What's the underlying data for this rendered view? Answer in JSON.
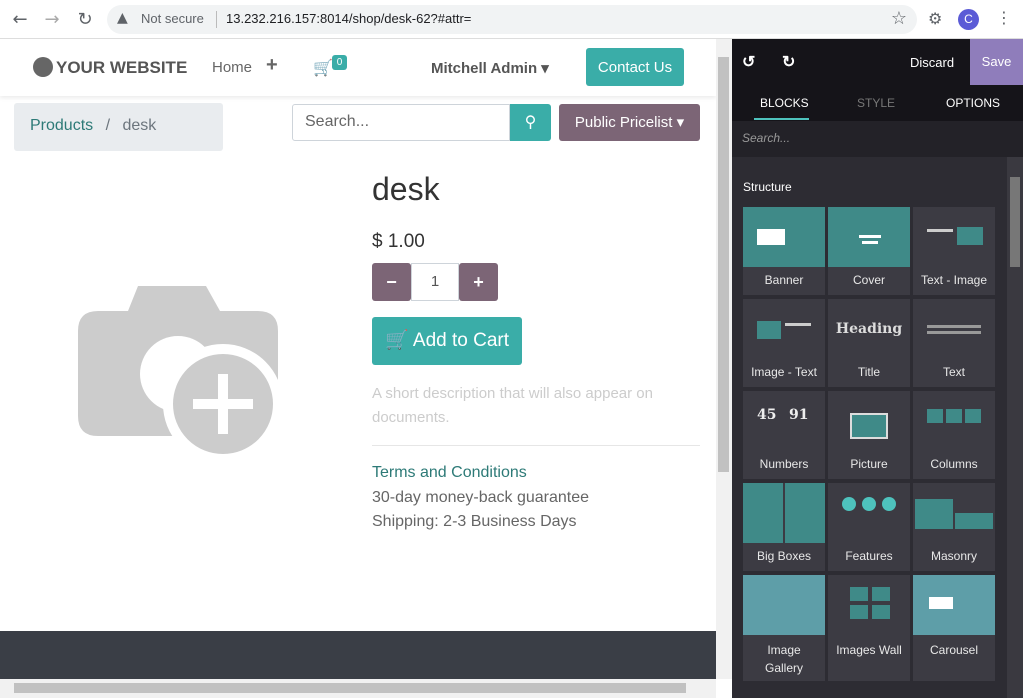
{
  "browser": {
    "security_label": "Not secure",
    "url": "13.232.216.157:8014/shop/desk-62?#attr=",
    "profile_initial": "C"
  },
  "header": {
    "logo": "YOUR WEBSITE",
    "home": "Home",
    "cart_count": "0",
    "user": "Mitchell Admin",
    "contact": "Contact Us"
  },
  "breadcrumb": {
    "products": "Products",
    "separator": "/",
    "current": "desk"
  },
  "search": {
    "placeholder": "Search..."
  },
  "pricelist": "Public Pricelist",
  "product": {
    "name": "desk",
    "price": "$ 1.00",
    "qty": "1",
    "add_to_cart": "Add to Cart",
    "short_desc": "A short description that will also appear on documents.",
    "terms": "Terms and Conditions",
    "guarantee": "30-day money-back guarantee",
    "shipping": "Shipping: 2-3 Business Days"
  },
  "editor": {
    "discard": "Discard",
    "save": "Save",
    "tabs": [
      "BLOCKS",
      "STYLE",
      "OPTIONS"
    ],
    "search_placeholder": "Search...",
    "section": "Structure",
    "blocks": [
      "Banner",
      "Cover",
      "Text - Image",
      "Image - Text",
      "Title",
      "Text",
      "Numbers",
      "Picture",
      "Columns",
      "Big Boxes",
      "Features",
      "Masonry",
      "Image Gallery",
      "Images Wall",
      "Carousel"
    ],
    "title_thumb": "Heading",
    "numbers_thumb": [
      "45",
      "91"
    ]
  }
}
